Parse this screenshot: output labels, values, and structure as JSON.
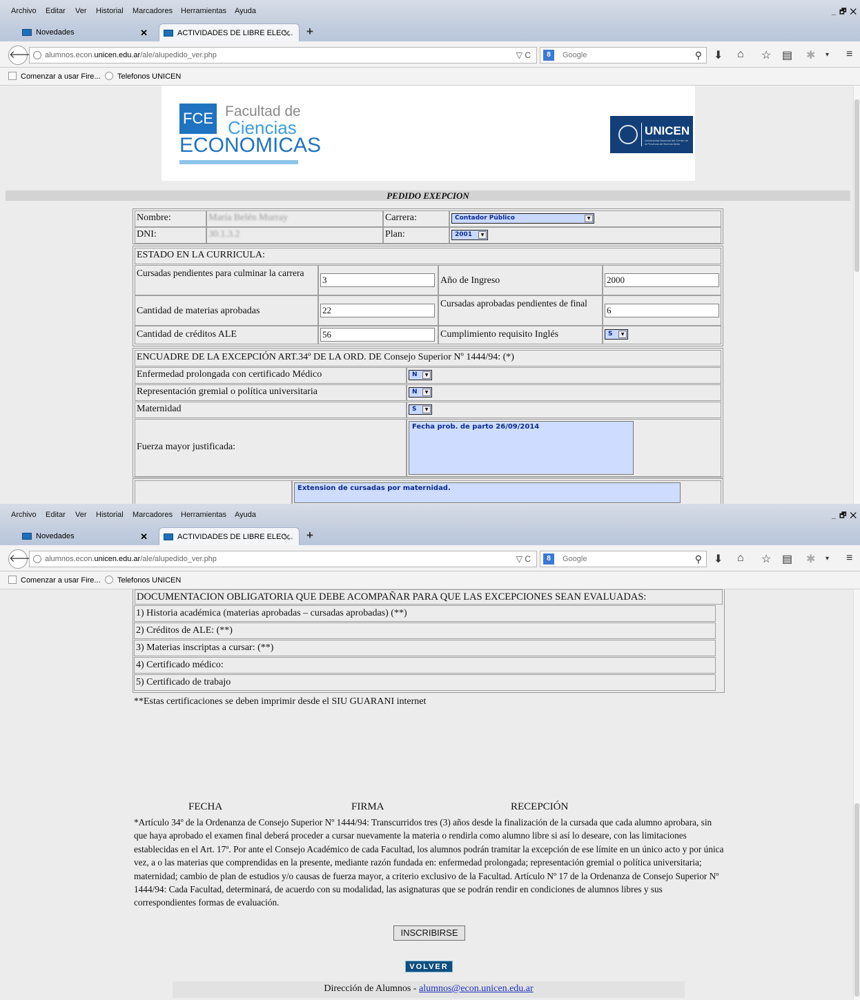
{
  "browser": {
    "menu": [
      "Archivo",
      "Editar",
      "Ver",
      "Historial",
      "Marcadores",
      "Herramientas",
      "Ayuda"
    ],
    "window_controls": "_ 🗗 ✕",
    "tabs": [
      {
        "label": "Novedades",
        "close": "✕"
      },
      {
        "label": "ACTIVIDADES DE LIBRE ELEC...",
        "close": "✕"
      }
    ],
    "new_tab": "+",
    "url_prefix": "alumnos.econ.",
    "url_domain": "unicen.edu.ar",
    "url_path": "/ale/alupedido_ver.php",
    "url_controls": "▽ C",
    "search_engine_badge": "8",
    "search_placeholder": "Google",
    "bookmarks": [
      "Comenzar a usar Fire...",
      "Telefonos UNICEN"
    ],
    "icons": [
      "back-arrow-icon",
      "globe-icon",
      "reload-icon",
      "search-icon",
      "download-icon",
      "home-icon",
      "star-icon",
      "reading-list-icon",
      "addon-icon",
      "menu-icon"
    ]
  },
  "header": {
    "fce_square": "FCE",
    "fce_line1": "Facultad de",
    "fce_line2": "Ciencias",
    "fce_line3": "ECONOMICAS",
    "unicen_name": "UNICEN",
    "unicen_small": "Universidad Nacional del Centro de la Provincia de Buenos Aires"
  },
  "form": {
    "title": "PEDIDO EXEPCION",
    "nombre_label": "Nombre:",
    "nombre_value": "María Belén Murray",
    "carrera_label": "Carrera:",
    "carrera_value": "Contador Público",
    "dni_label": "DNI:",
    "dni_value": "30.1.3.2",
    "plan_label": "Plan:",
    "plan_value": "2001",
    "estado_title": "ESTADO EN LA CURRICULA:",
    "cursadas_pend_label": "Cursadas pendientes para culminar la carrera",
    "cursadas_pend_value": "3",
    "anio_ingreso_label": "Año de Ingreso",
    "anio_ingreso_value": "2000",
    "materias_aprob_label": "Cantidad de materias aprobadas",
    "materias_aprob_value": "22",
    "cursadas_aprob_label": "Cursadas aprobadas pendientes de final",
    "cursadas_aprob_value": "6",
    "creditos_label": "Cantidad de créditos ALE",
    "creditos_value": "56",
    "ingles_label": "Cumplimiento requisito Inglés",
    "ingles_value": "S",
    "encuadre_title": "ENCUADRE DE LA EXCEPCIÓN ART.34º DE LA ORD. DE Consejo Superior Nº 1444/94: (*)",
    "enfermedad_label": "Enfermedad prolongada con certificado Médico",
    "enfermedad_value": "N",
    "representacion_label": "Representación gremial o política universitaria",
    "representacion_value": "N",
    "maternidad_label": "Maternidad",
    "maternidad_value": "S",
    "fuerza_label": "Fuerza mayor justificada:",
    "fuerza_value": "Fecha prob. de parto 26/09/2014",
    "observ_value": "Extension de cursadas por maternidad."
  },
  "docs": {
    "title": "DOCUMENTACION OBLIGATORIA QUE DEBE ACOMPAÑAR PARA QUE LAS EXCEPCIONES SEAN EVALUADAS:",
    "items": [
      "1) Historia académica (materias aprobadas – cursadas aprobadas) (**)",
      "2) Créditos de ALE: (**)",
      "3) Materias inscriptas a cursar: (**)",
      "4) Certificado médico:",
      "5) Certificado de trabajo"
    ],
    "note": "**Estas certificaciones se deben imprimir desde el SIU GUARANI internet"
  },
  "signature": {
    "fecha": "FECHA",
    "firma": "FIRMA",
    "recepcion": "RECEPCIÓN"
  },
  "article": "*Artículo 34º de la Ordenanza de Consejo Superior Nº 1444/94: Transcurridos tres (3) años desde la finalización de la cursada que cada alumno aprobara, sin que haya aprobado el examen final deberá proceder a cursar nuevamente la materia o rendirla como alumno libre si así lo deseare, con las limitaciones establecidas en el Art. 17º. Por ante el Consejo Académico de cada Facultad, los alumnos podrán tramitar la excepción de ese límite en un único acto y por única vez, a o las materias que comprendidas en la presente, mediante razón fundada en: enfermedad prolongada; representación gremial o política universitaria; maternidad; cambio de plan de estudios y/o causas de fuerza mayor, a criterio exclusivo de la Facultad. Artículo Nº 17 de la Ordenanza de Consejo Superior Nº 1444/94: Cada Facultad, determinará, de acuerdo con su modalidad, las asignaturas que se podrán rendir en condiciones de alumnos libres y sus correspondientes formas de evaluación.",
  "buttons": {
    "inscribirse": "INSCRIBIRSE",
    "volver": "VOLVER"
  },
  "footer": {
    "text": "Dirección de Alumnos - ",
    "email": "alumnos@econ.unicen.edu.ar"
  }
}
